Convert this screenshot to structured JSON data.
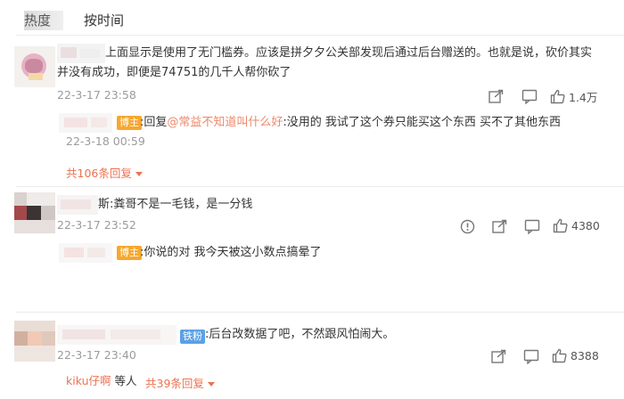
{
  "tabs": [
    {
      "label": "热度"
    },
    {
      "label": "按时间"
    }
  ],
  "comments": [
    {
      "text_line1": "上面显示是使用了无门槛券。应该是拼夕夕公关部发现后通过后台赠送的。也就是说，砍价其实",
      "text_line2": "并没有成功，即便是74751的几千人帮你砍了",
      "time": "22-3-17 23:58",
      "likes": "1.4万",
      "reply": {
        "badge": "博主",
        "prefix": ":回复",
        "mention": "@常益不知道叫什么好",
        "text": ":没用的 我试了这个券只能买这个东西 买不了其他东西",
        "time": "22-3-18 00:59"
      },
      "expand": "共106条回复"
    },
    {
      "text": "斯:粪哥不是一毛钱，是一分钱",
      "time": "22-3-17 23:52",
      "likes": "4380",
      "reply": {
        "badge": "博主",
        "text": ":你说的对 我今天被这小数点搞晕了"
      }
    },
    {
      "badge": "铁粉",
      "text": ":后台改数据了吧，不然跟风怕闹大。",
      "time": "22-3-17 23:40",
      "likes": "8388",
      "reply_user": "kiku仔啊",
      "reply_suffix": " 等人",
      "expand": "共39条回复"
    }
  ],
  "colors": {
    "accent": "#eb7350",
    "host_badge": "#f6a72d",
    "fan_badge": "#5aa1e6",
    "meta_gray": "#9b9b9b"
  },
  "icons": [
    "comment-icon",
    "share-icon",
    "like-icon",
    "report-icon",
    "chevron-down-icon"
  ]
}
